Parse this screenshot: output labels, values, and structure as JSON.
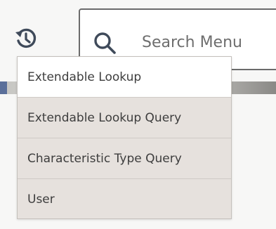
{
  "header": {
    "history_icon": "history-icon",
    "search": {
      "icon": "search-icon",
      "placeholder": "Search Menu",
      "value": ""
    }
  },
  "recent_menu": {
    "items": [
      {
        "label": "Extendable Lookup",
        "active": true
      },
      {
        "label": "Extendable Lookup Query",
        "active": false
      },
      {
        "label": "Characteristic Type Query",
        "active": false
      },
      {
        "label": "User",
        "active": false
      }
    ]
  },
  "colors": {
    "icon": "#3f4a5a",
    "menu_bg": "#e6e1dd",
    "menu_active_bg": "#ffffff",
    "menu_text": "#3d3d3d"
  }
}
